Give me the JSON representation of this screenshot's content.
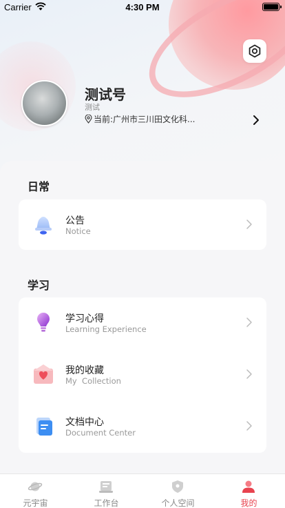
{
  "status_bar": {
    "carrier": "Carrier",
    "time": "4:30 PM"
  },
  "profile": {
    "name": "测试号",
    "subtitle": "测试",
    "location": "当前:广州市三川田文化科..."
  },
  "sections": [
    {
      "title": "日常",
      "items": [
        {
          "title": "公告",
          "subtitle": "Notice",
          "icon": "bell-icon"
        }
      ]
    },
    {
      "title": "学习",
      "items": [
        {
          "title": "学习心得",
          "subtitle": "Learning Experience",
          "icon": "lightbulb-icon"
        },
        {
          "title": "我的收藏",
          "subtitle": "My  Collection",
          "icon": "heart-envelope-icon"
        },
        {
          "title": "文档中心",
          "subtitle": "Document Center",
          "icon": "document-icon"
        }
      ]
    }
  ],
  "tabbar": {
    "tabs": [
      {
        "label": "元宇宙",
        "icon": "planet-icon",
        "active": false
      },
      {
        "label": "工作台",
        "icon": "workbench-icon",
        "active": false
      },
      {
        "label": "个人空间",
        "icon": "shield-icon",
        "active": false
      },
      {
        "label": "我的",
        "icon": "user-icon",
        "active": true
      }
    ]
  },
  "colors": {
    "accent": "#e8434f",
    "planet": "#f7a4a9",
    "card": "#ffffff"
  }
}
